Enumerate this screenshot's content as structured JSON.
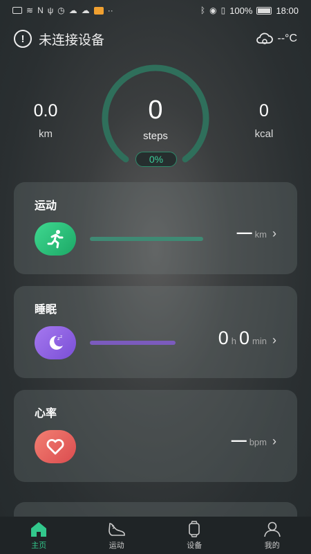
{
  "status_bar": {
    "network": "N",
    "battery": "100%",
    "time": "18:00"
  },
  "header": {
    "connection_text": "未连接设备",
    "weather_temp": "--°C"
  },
  "stats": {
    "distance_value": "0.0",
    "distance_unit": "km",
    "steps_value": "0",
    "steps_unit": "steps",
    "steps_percent": "0%",
    "steps_progress": 0,
    "calories_value": "0",
    "calories_unit": "kcal"
  },
  "cards": {
    "exercise": {
      "title": "运动",
      "value": "—",
      "unit": "km"
    },
    "sleep": {
      "title": "睡眠",
      "hours": "0",
      "hours_unit": "h",
      "minutes": "0",
      "minutes_unit": "min"
    },
    "heart": {
      "title": "心率",
      "value": "—",
      "unit": "bpm"
    }
  },
  "nav": {
    "home": "主页",
    "sport": "运动",
    "device": "设备",
    "mine": "我的"
  },
  "colors": {
    "accent": "#32c88c",
    "ring": "#2f6f5b",
    "run_icon": "#2fc07a",
    "sleep_icon": "#8b62e4",
    "heart_icon": "#e6615f"
  }
}
